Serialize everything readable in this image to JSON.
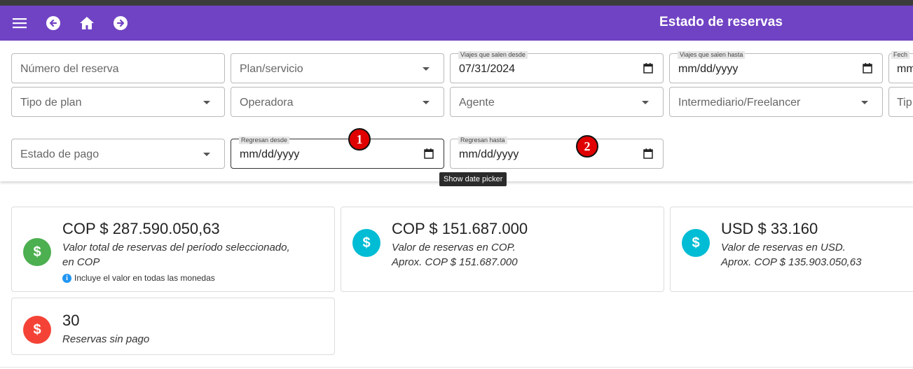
{
  "appbar": {
    "title": "Estado de reservas",
    "color": "#7043c4",
    "icons": [
      "menu-icon",
      "back-arrow-icon",
      "home-icon",
      "forward-arrow-icon"
    ]
  },
  "filters": {
    "numero_reserva": {
      "placeholder": "Número del reserva"
    },
    "plan_servicio": {
      "placeholder": "Plan/servicio"
    },
    "viajes_desde": {
      "label": "Viajes que salen desde",
      "value": "07/31/2024"
    },
    "viajes_hasta": {
      "label": "Viajes que salen hasta",
      "value": "mm/dd/yyyy"
    },
    "fecha_partial": {
      "label": "Fech",
      "value": "mm"
    },
    "tipo_plan": {
      "placeholder": "Tipo de plan"
    },
    "operadora": {
      "placeholder": "Operadora"
    },
    "agente": {
      "placeholder": "Agente"
    },
    "intermediario": {
      "placeholder": "Intermediario/Freelancer"
    },
    "tipo_partial": {
      "placeholder": "Tip"
    },
    "estado_pago": {
      "placeholder": "Estado de pago"
    },
    "regresan_desde": {
      "label": "Regresan desde",
      "value": "mm/dd/yyyy"
    },
    "regresan_hasta": {
      "label": "Regresan hasta",
      "value": "mm/dd/yyyy"
    }
  },
  "markers": {
    "one": "1",
    "two": "2",
    "color": "#e00000"
  },
  "tooltip": "Show date picker",
  "cards": {
    "total": {
      "amount": "COP $ 287.590.050,63",
      "desc_line1": "Valor total de reservas del período seleccionado,",
      "desc_line2": "en COP",
      "note": "Incluye el valor en todas las monedas",
      "icon_color": "#4caf50"
    },
    "cop": {
      "amount": "COP $ 151.687.000",
      "desc_line1": "Valor de reservas en COP.",
      "desc_line2": "Aprox. COP $ 151.687.000",
      "icon_color": "#00bcd4"
    },
    "usd": {
      "amount": "USD $ 33.160",
      "desc_line1": "Valor de reservas en USD.",
      "desc_line2": "Aprox. COP $ 135.903.050,63",
      "icon_color": "#00bcd4"
    },
    "sin_pago": {
      "amount": "30",
      "desc_line1": "Reservas sin pago",
      "icon_color": "#f44336"
    }
  }
}
